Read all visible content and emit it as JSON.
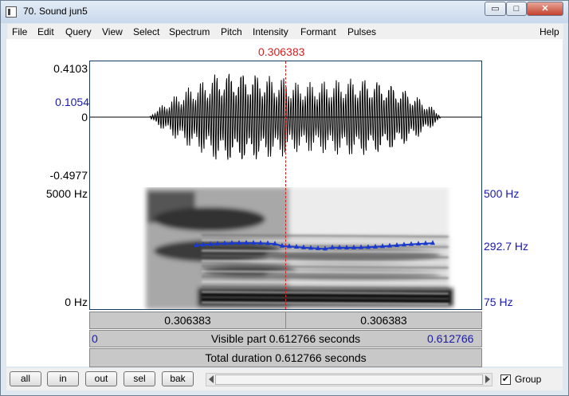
{
  "window": {
    "title": "70. Sound jun5",
    "controls": {
      "minimize": "▭",
      "maximize": "□",
      "close": "✕"
    }
  },
  "menu": [
    "File",
    "Edit",
    "Query",
    "View",
    "Select",
    "Spectrum",
    "Pitch",
    "Intensity",
    "Formant",
    "Pulses",
    "Help"
  ],
  "cursor_time": "0.306383",
  "wave_labels": {
    "max": "0.4103",
    "cursor_value": "0.1054",
    "zero": "0",
    "min": "-0.4977"
  },
  "spectrogram_labels": {
    "top_freq": "5000 Hz",
    "bottom_freq": "0 Hz"
  },
  "pitch_labels": {
    "top": "500 Hz",
    "value": "292.7 Hz",
    "bottom": "75 Hz"
  },
  "bars": {
    "left_time": "0.306383",
    "right_time": "0.306383",
    "visible_start": "0",
    "visible_text": "Visible part 0.612766 seconds",
    "visible_end": "0.612766",
    "total_text": "Total duration 0.612766 seconds"
  },
  "bottom": {
    "buttons": [
      "all",
      "in",
      "out",
      "sel",
      "bak"
    ],
    "group_label": "Group",
    "group_checked": true
  },
  "colors": {
    "cursor": "#d42020",
    "pitch": "#1a3acc",
    "frame": "#1a3a5c",
    "blue_text": "#1a1aaa"
  }
}
